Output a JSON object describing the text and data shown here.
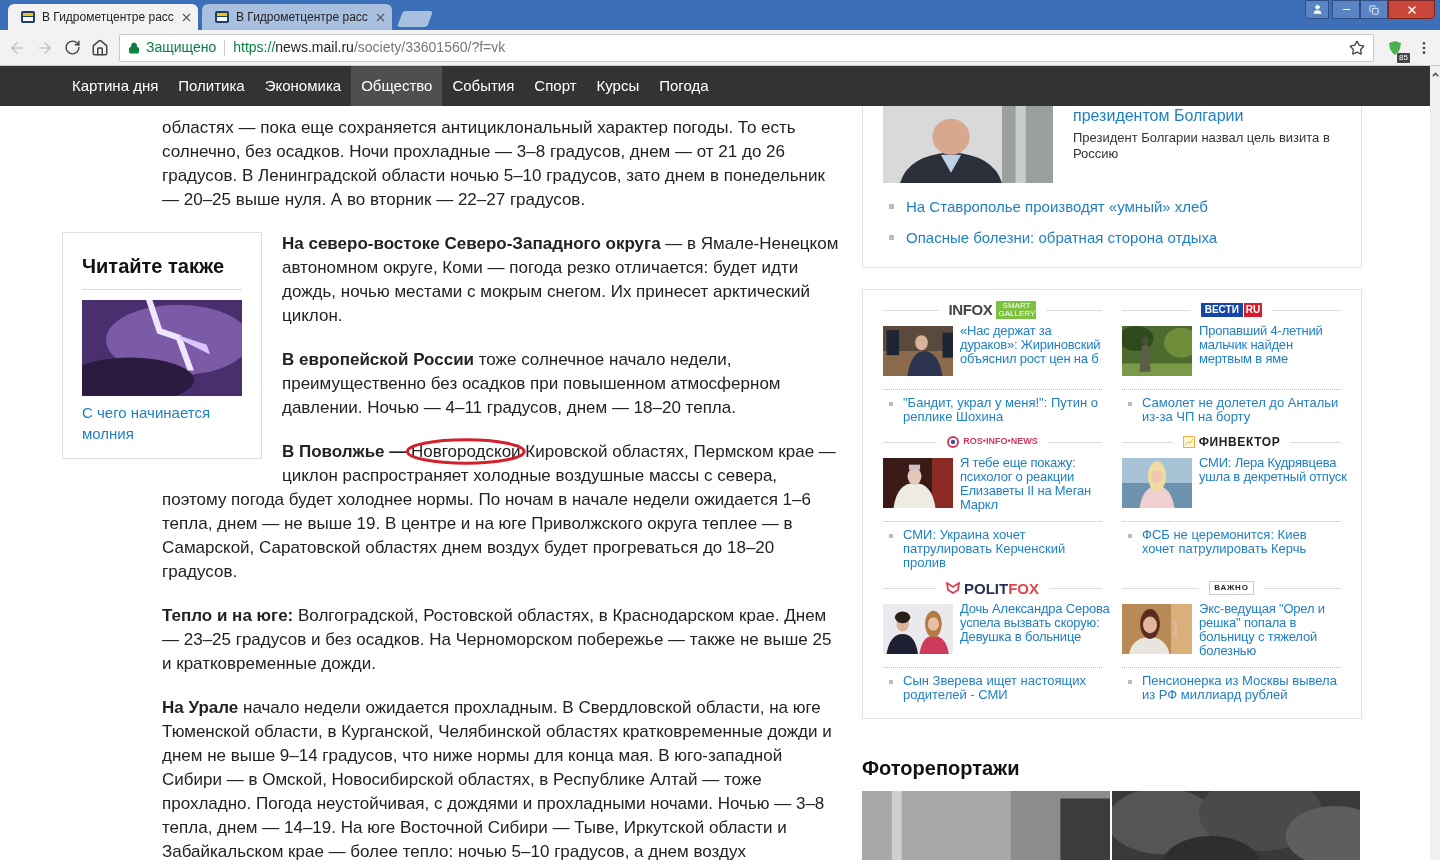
{
  "browser": {
    "tabs": [
      {
        "title": "В Гидрометцентре расс",
        "selected": true
      },
      {
        "title": "В Гидрометцентре расс",
        "selected": false
      }
    ],
    "address": {
      "security": "Защищено",
      "scheme": "https://",
      "host": "news.mail.ru",
      "path": "/society/33601560/?f=vk"
    },
    "extension_badge": "85"
  },
  "nav": [
    {
      "label": "Картина дня",
      "selected": false
    },
    {
      "label": "Политика",
      "selected": false
    },
    {
      "label": "Экономика",
      "selected": false
    },
    {
      "label": "Общество",
      "selected": true
    },
    {
      "label": "События",
      "selected": false
    },
    {
      "label": "Спорт",
      "selected": false
    },
    {
      "label": "Курсы",
      "selected": false
    },
    {
      "label": "Погода",
      "selected": false
    }
  ],
  "article": {
    "paragraphs": [
      {
        "text": "областях — пока еще сохраняется антициклональный характер погоды. То есть солнечно, без осадков. Ночи прохладные — 3–8 градусов, днем — от 21 до 26 градусов. В Ленинградской области ночью 5–10 градусов, зато днем в понедельник — 20–25 выше нуля. А во вторник — 22–27 градусов."
      },
      {
        "text": "**На северо-востоке Северо-Западного округа** — в Ямале-Ненецком автономном округе, Коми — погода резко отличается: будет идти дождь, ночью местами с мокрым снегом. Их принесет арктический циклон."
      },
      {
        "text": "**В европейской России** тоже солнечное начало недели, преимущественно без осадков при повышенном атмосферном давлении. Ночью — 4–11 градусов, днем — 18–20 тепла."
      },
      {
        "before": "**В Поволжье —** ",
        "marked": "Новгородской",
        "after": " Кировской областях, Пермском крае — циклон распространяет холодные воздушные массы с севера,",
        "continued": "поэтому погода будет холоднее нормы. По ночам в начале недели ожидается 1–6 тепла, днем — не выше 19. В центре и на юге Приволжского округа теплее — в Самарской, Саратовской областях днем воздух будет прогреваться до 18–20 градусов."
      },
      {
        "text": "**Тепло и на юге:** Волгоградской, Ростовской областях, в Краснодарском крае. Днем — 23–25 градусов и без осадков. На Черноморском побережье — также не выше 25 и кратковременные дожди."
      },
      {
        "text": "**На Урале** начало недели ожидается прохладным. В Свердловской области, на юге Тюменской области, в Курганской, Челябинской областях кратковременные дожди и днем не выше 9–14 градусов, что ниже нормы для конца мая. В юго-западной Сибири — в Омской, Новосибирской областях, в Республике Алтай — тоже прохладно. Погода неустойчивая, с дождями и прохладными ночами. Ночью — 3–8 тепла, днем — 14–19. На юге Восточной Сибири — Тыве, Иркутской области и Забайкальском крае — более тепло: ночью 5–10 градусов, а днем воздух"
      }
    ]
  },
  "read_also": {
    "title": "Читайте также",
    "link": "С чего начинается молния"
  },
  "sidebar": {
    "top_story": {
      "title": "президентом Болгарии",
      "summary": "Президент Болгарии назвал цель визита в Россию",
      "links": [
        "На Ставрополье производят «умный» хлеб",
        "Опасные болезни: обратная сторона отдыха"
      ]
    },
    "partners": [
      {
        "kind": "infox",
        "logo": "INFOX",
        "badge": "SMART GALLERY",
        "headline": "«Нас держат за дураков»: Жириновский объяснил рост цен на б",
        "link": "\"Бандит, украл у меня!\": Путин о реплике Шохина"
      },
      {
        "kind": "vesti",
        "logo": "ВЕСТИ",
        "badge": "RU",
        "headline": "Пропавший 4-летний мальчик найден мертвым в яме",
        "link": "Самолет не долетел до Антальи из-за ЧП на борту"
      },
      {
        "kind": "rosinfo",
        "logo": "ROS•INFO•NEWS",
        "headline": "Я тебе еще покажу: психолог о реакции Елизаветы II на Меган Маркл",
        "link": "СМИ: Украина хочет патрулировать Керченский пролив"
      },
      {
        "kind": "finvector",
        "logo": "ФИНВЕКТОР",
        "headline": "СМИ: Лера Кудрявцева ушла в декретный отпуск",
        "link": "ФСБ не церемонится: Киев хочет патрулировать Керчь"
      },
      {
        "kind": "politfox",
        "logo": "POLIT",
        "badge": "FOX",
        "headline": "Дочь Александра Серова успела вызвать скорую: Девушка в больнице",
        "link": "Сын Зверева ищет настоящих родителей - СМИ"
      },
      {
        "kind": "vazhno",
        "logo": "ВАЖНО",
        "headline": "Экс-ведущая \"Орел и решка\" попала в больницу с тяжелой болезнью",
        "link": "Пенсионерка из Москвы вывела из РФ миллиард рублей"
      }
    ],
    "photo_section": {
      "title": "Фоторепортажи"
    }
  }
}
